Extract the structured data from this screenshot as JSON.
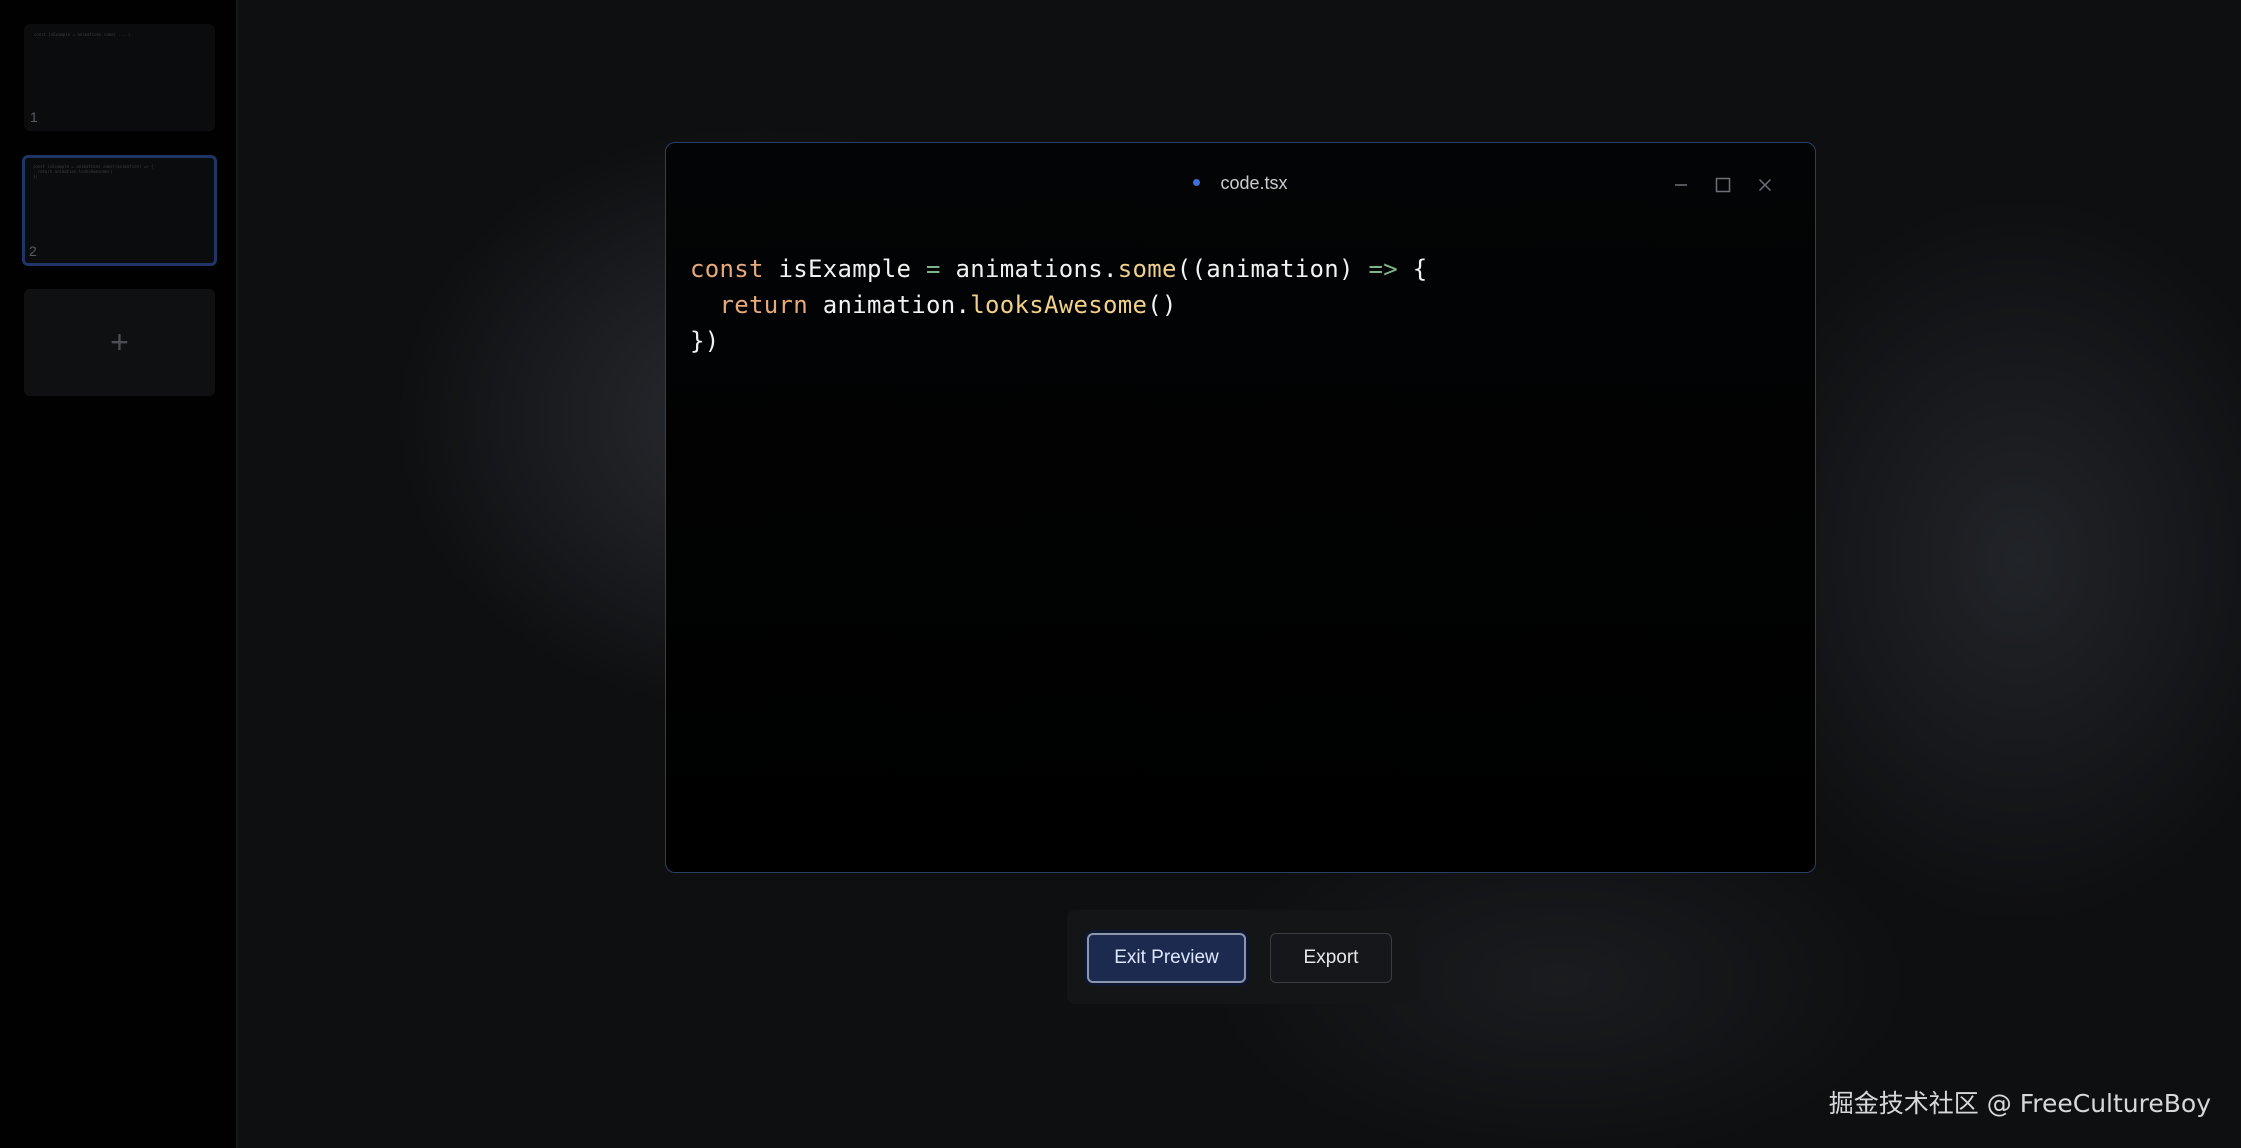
{
  "sidebar": {
    "slides": [
      {
        "number": "1",
        "preview_code": "const isExample = animations.some( ... )"
      },
      {
        "number": "2",
        "preview_code": "const isExample = animations.some((animation) => {\n  return animation.looksAwesome()\n})"
      }
    ],
    "add_slide_label": "+"
  },
  "window": {
    "filename": "code.tsx",
    "code_lines": [
      [
        {
          "type": "kw",
          "text": "const"
        },
        {
          "type": "pl",
          "text": " isExample "
        },
        {
          "type": "op",
          "text": "="
        },
        {
          "type": "pl",
          "text": " animations."
        },
        {
          "type": "fn",
          "text": "some"
        },
        {
          "type": "pl",
          "text": "((animation) "
        },
        {
          "type": "op",
          "text": "=>"
        },
        {
          "type": "pl",
          "text": " {"
        }
      ],
      [
        {
          "type": "pl",
          "text": "  "
        },
        {
          "type": "kw",
          "text": "return"
        },
        {
          "type": "pl",
          "text": " animation."
        },
        {
          "type": "fn",
          "text": "looksAwesome"
        },
        {
          "type": "pl",
          "text": "()"
        }
      ],
      [
        {
          "type": "pl",
          "text": "})"
        }
      ]
    ]
  },
  "toolbar": {
    "exit_preview_label": "Exit Preview",
    "export_label": "Export"
  },
  "watermark": "掘金技术社区 @ FreeCultureBoy",
  "colors": {
    "accent": "#3f6fd8",
    "window_border": "#284067",
    "keyword": "#e7a97a",
    "function": "#f0d08a",
    "operator": "#7fb58a"
  },
  "icons": {
    "minimize": "minimize-icon",
    "maximize": "maximize-icon",
    "close": "close-icon",
    "add": "plus-icon"
  }
}
